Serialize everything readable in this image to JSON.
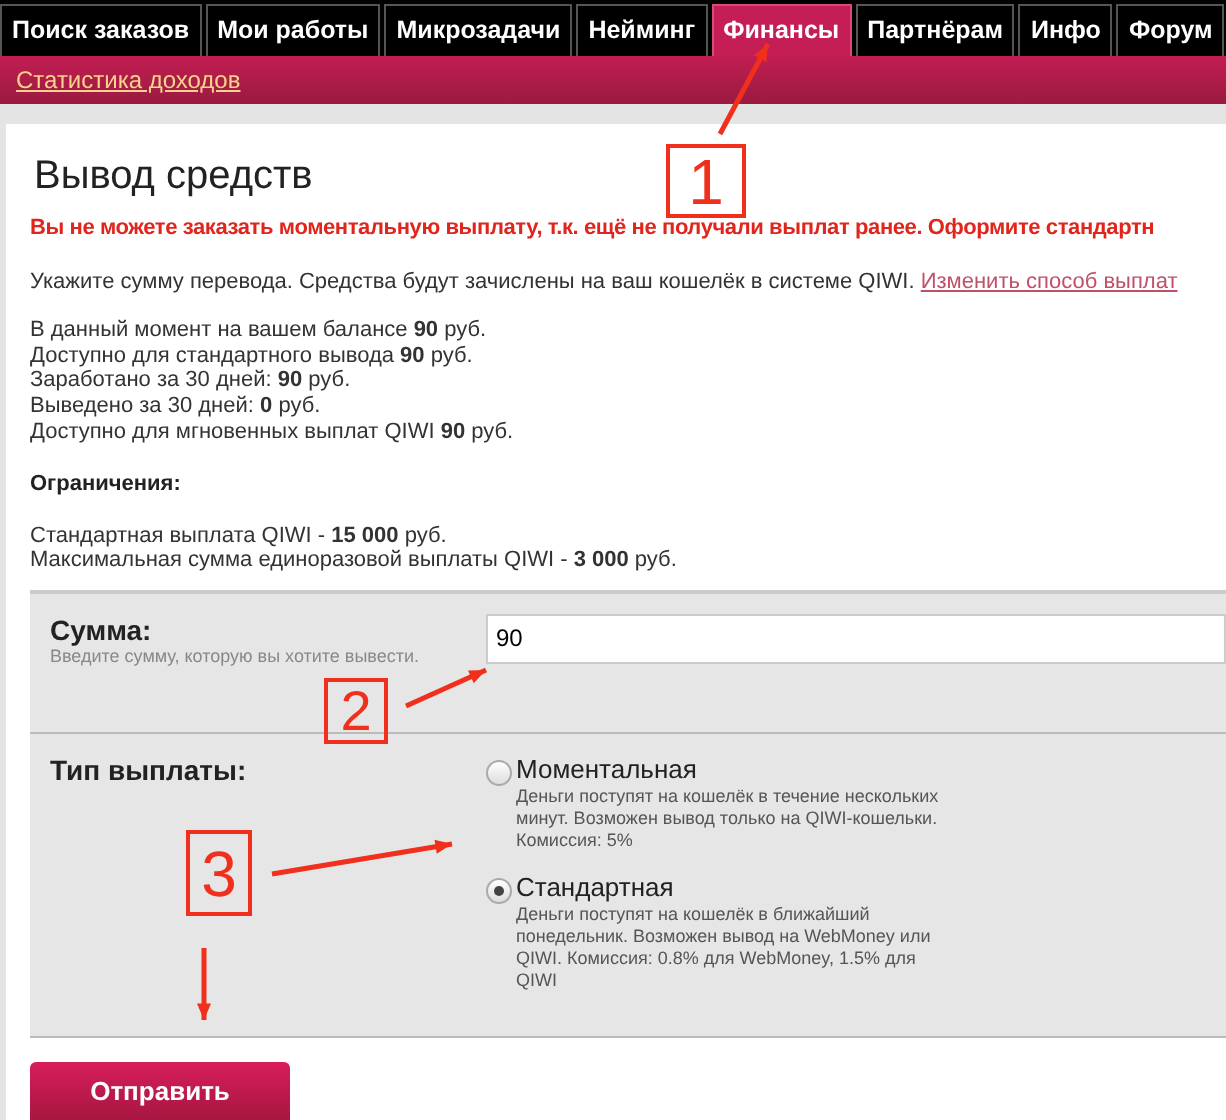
{
  "tabs": [
    {
      "label": "Поиск заказов",
      "selected": false
    },
    {
      "label": "Мои работы",
      "selected": false
    },
    {
      "label": "Микрозадачи",
      "selected": false
    },
    {
      "label": "Нейминг",
      "selected": false
    },
    {
      "label": "Финансы",
      "selected": true
    },
    {
      "label": "Партнёрам",
      "selected": false
    },
    {
      "label": "Инфо",
      "selected": false
    },
    {
      "label": "Форум",
      "selected": false
    }
  ],
  "sub_nav": {
    "link": "Статистика доходов"
  },
  "title": "Вывод средств",
  "warning": "Вы не можете заказать моментальную выплату, т.к. ещё не получали выплат ранее. Оформите стандартн",
  "intro": {
    "text": "Укажите сумму перевода. Средства будут зачислены на ваш кошелёк в системе QIWI.",
    "link": "Изменить способ выплат"
  },
  "balance_lines": [
    "В данный момент на вашем балансе **90** руб.",
    "Доступно для стандартного вывода **90** руб.",
    "Заработано за 30 дней: **90** руб.",
    "Выведено за 30 дней: **0** руб.",
    "Доступно для мгновенных выплат QIWI **90** руб."
  ],
  "limits": {
    "heading": "Ограничения:",
    "lines": [
      "Стандартная выплата QIWI - **15 000** руб.",
      "Максимальная сумма единоразовой выплаты QIWI - **3 000** руб."
    ]
  },
  "amount": {
    "label": "Сумма:",
    "hint": "Введите сумму, которую вы хотите вывести.",
    "value": "90"
  },
  "payout_type": {
    "label": "Тип выплаты:",
    "options": [
      {
        "title": "Моментальная",
        "description": "Деньги поступят на кошелёк в течение нескольких минут. Возможен вывод только на QIWI-кошельки. Комиссия: 5%",
        "selected": false
      },
      {
        "title": "Стандартная",
        "description": "Деньги поступят на кошелёк в ближайший понедельник. Возможен вывод на WebMoney или QIWI. Комиссия: 0.8% для WebMoney, 1.5% для QIWI",
        "selected": true
      }
    ]
  },
  "submit_button": "Отправить",
  "annotations": [
    "1",
    "2",
    "3"
  ]
}
